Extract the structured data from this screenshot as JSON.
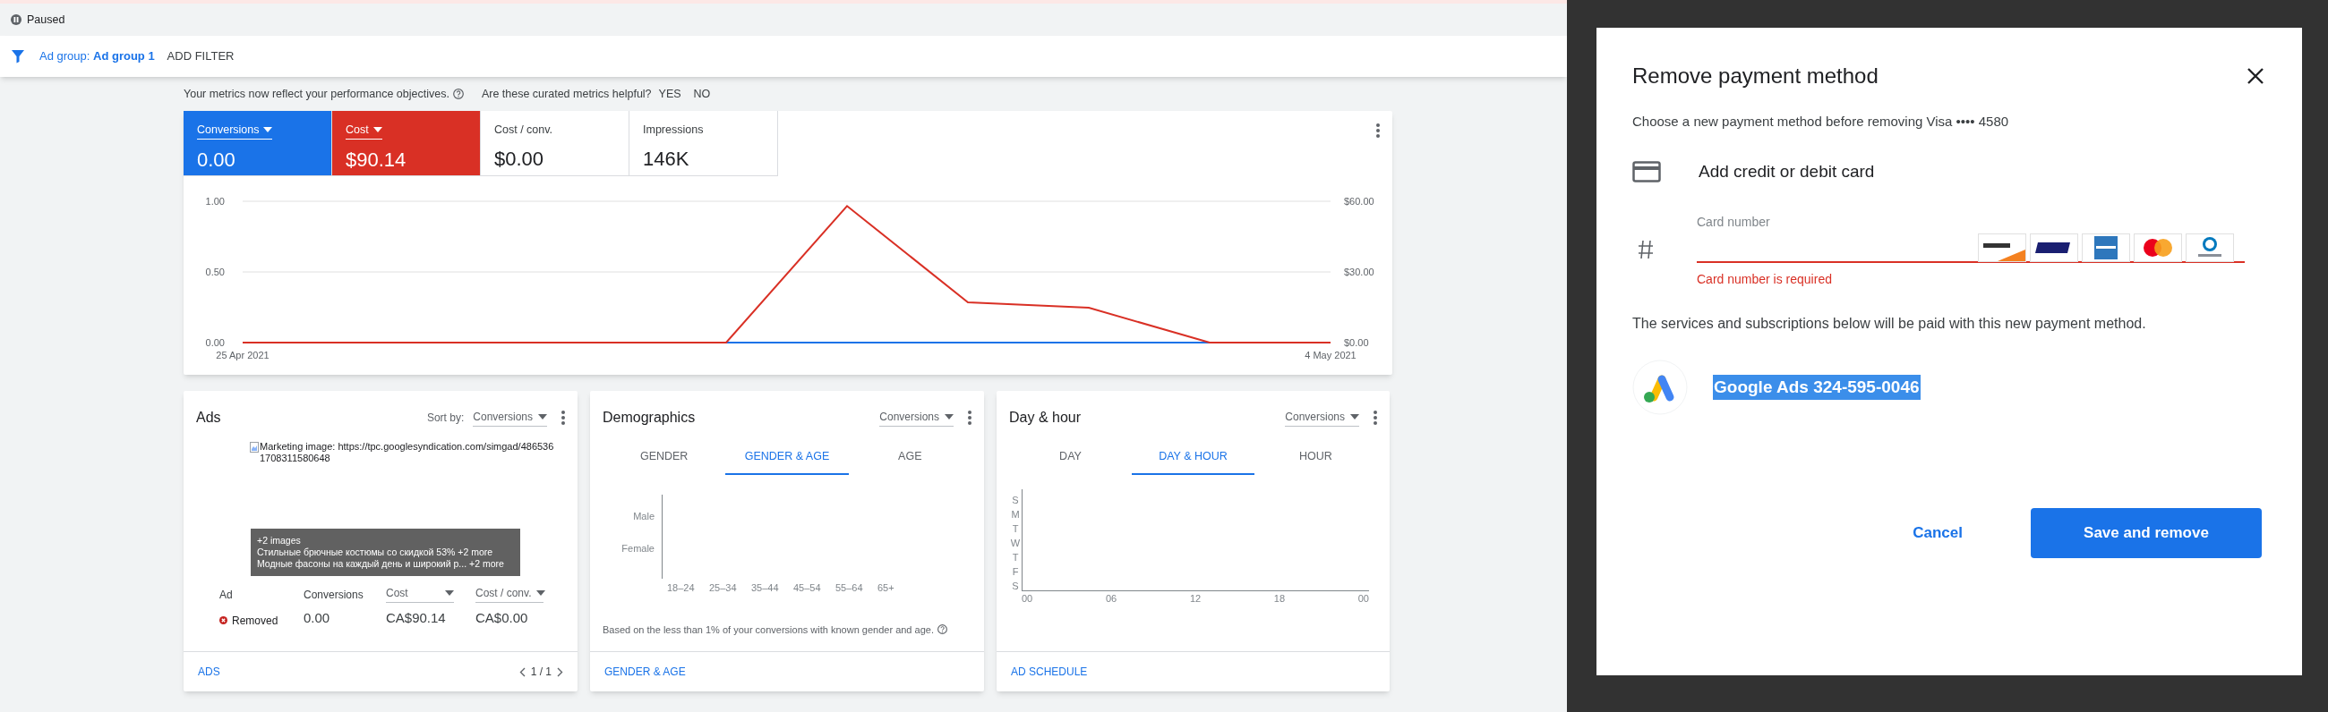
{
  "status": {
    "label": "Paused"
  },
  "filter_bar": {
    "filter_label": "Ad group:",
    "filter_value": "Ad group 1",
    "add_filter": "ADD FILTER"
  },
  "metrics_note": {
    "text": "Your metrics now reflect your performance objectives.",
    "question": "Are these curated metrics helpful?",
    "yes": "YES",
    "no": "NO"
  },
  "metric_tiles": [
    {
      "label": "Conversions",
      "value": "0.00",
      "selected": true,
      "color": "#1a73e8"
    },
    {
      "label": "Cost",
      "value": "$90.14",
      "selected": true,
      "color": "#d93025"
    },
    {
      "label": "Cost / conv.",
      "value": "$0.00",
      "selected": false
    },
    {
      "label": "Impressions",
      "value": "146K",
      "selected": false
    }
  ],
  "chart": {
    "chart_data": {
      "type": "line",
      "categories": [
        "25 Apr 2021",
        null,
        null,
        null,
        null,
        null,
        null,
        null,
        null,
        "4 May 2021"
      ],
      "ylim": [
        0,
        1
      ],
      "yticks": [
        {
          "value": 0,
          "label": "0.00"
        },
        {
          "value": 0.5,
          "label": "0.50"
        },
        {
          "value": 1,
          "label": "1.00"
        }
      ],
      "y2lim": [
        0,
        60
      ],
      "y2ticks": [
        {
          "value": 0,
          "label": "$0.00"
        },
        {
          "value": 30,
          "label": "$30.00"
        },
        {
          "value": 60,
          "label": "$60.00"
        }
      ],
      "series": [
        {
          "color": "#1a73e8",
          "values": [
            null,
            null,
            null,
            null,
            0,
            0,
            0,
            0,
            0,
            0
          ]
        },
        {
          "color": "#d93025",
          "axis": "y2",
          "values": [
            0,
            0,
            0,
            0,
            0,
            58,
            17.1,
            14.8,
            0,
            0
          ]
        }
      ]
    }
  },
  "ads_card": {
    "title": "Ads",
    "sort_label": "Sort by:",
    "sort_value": "Conversions",
    "image_alt": "Marketing image: https://tpc.googlesyndication.com/simgad/4865361708311580648",
    "overlay_lines": [
      "+2 images",
      "Стильные брючные костюмы со скидкой 53% +2 more",
      "Модные фасоны на каждый день и широкий р... +2 more"
    ],
    "columns": [
      {
        "label": "Ad",
        "sortable": false
      },
      {
        "label": "Conversions",
        "sortable": false
      },
      {
        "label": "Cost",
        "sortable": true
      },
      {
        "label": "Cost / conv.",
        "sortable": true
      }
    ],
    "row": [
      {
        "text": "Removed",
        "kind": "removed"
      },
      {
        "text": "0.00",
        "kind": "number"
      },
      {
        "text": "CA$90.14",
        "kind": "number"
      },
      {
        "text": "CA$0.00",
        "kind": "number"
      }
    ],
    "link": "ADS",
    "pager": "1 / 1"
  },
  "demographics_card": {
    "title": "Demographics",
    "metric": "Conversions",
    "tabs": [
      {
        "label": "GENDER",
        "selected": false
      },
      {
        "label": "GENDER & AGE",
        "selected": true
      },
      {
        "label": "AGE",
        "selected": false
      }
    ],
    "rows": [
      "Male",
      "Female"
    ],
    "columns": [
      "18–24",
      "25–34",
      "35–44",
      "45–54",
      "55–64",
      "65+"
    ],
    "note": "Based on the less than 1% of your conversions with known gender and age.",
    "link": "GENDER & AGE"
  },
  "day_hour_card": {
    "title": "Day & hour",
    "metric": "Conversions",
    "tabs": [
      {
        "label": "DAY",
        "selected": false
      },
      {
        "label": "DAY & HOUR",
        "selected": true
      },
      {
        "label": "HOUR",
        "selected": false
      }
    ],
    "days": [
      "S",
      "M",
      "T",
      "W",
      "T",
      "F",
      "S"
    ],
    "hours": [
      "00",
      "06",
      "12",
      "18",
      "00"
    ],
    "link": "AD SCHEDULE"
  },
  "dialog": {
    "title": "Remove payment method",
    "subtitle": "Choose a new payment method before removing Visa •••• 4580",
    "add_card": "Add credit or debit card",
    "card_field": {
      "placeholder": "Card number",
      "error": "Card number is required"
    },
    "paragraph": "The services and subscriptions below will be paid with this new payment method.",
    "service": {
      "label": "Google Ads 324-595-0046",
      "selected": true
    },
    "cancel": "Cancel",
    "confirm": "Save and remove"
  }
}
